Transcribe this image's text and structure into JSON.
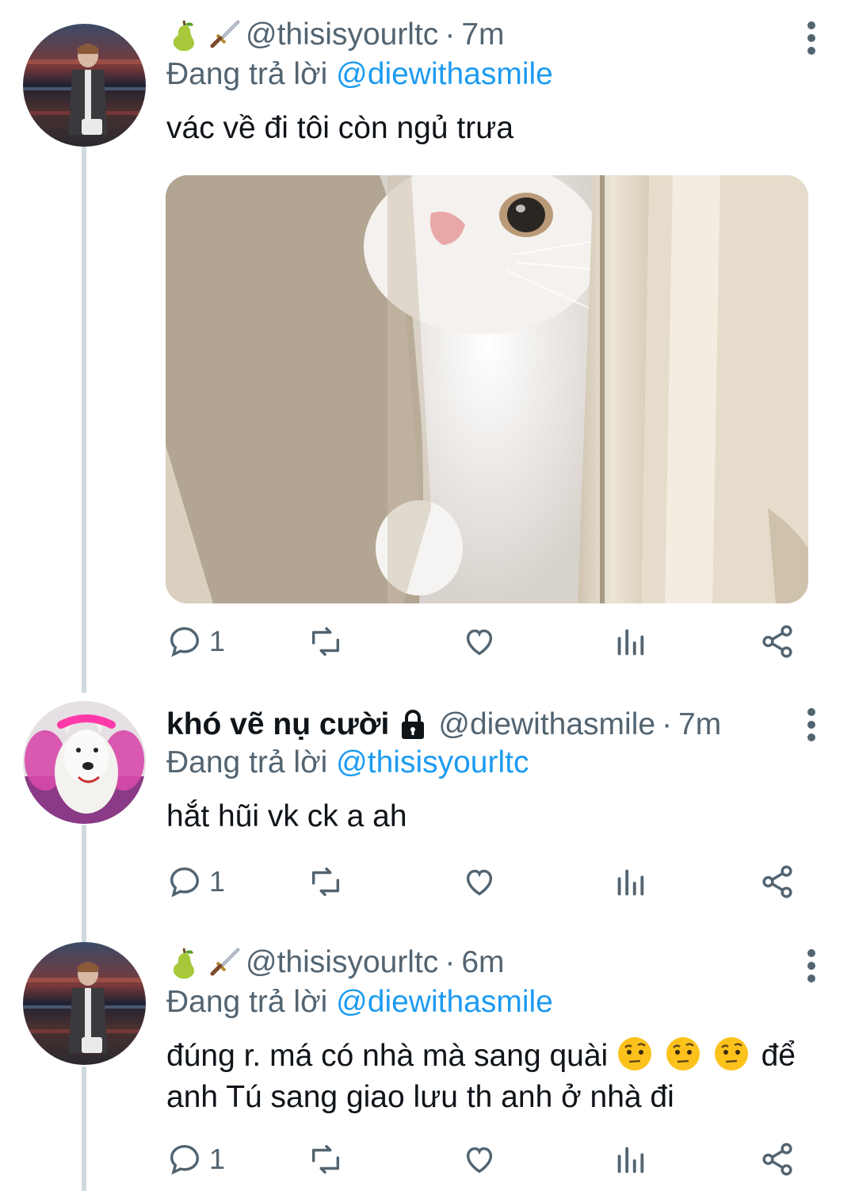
{
  "tweets": [
    {
      "header_emojis": [
        "pear",
        "dagger"
      ],
      "display_name": "",
      "locked": false,
      "handle": "@thisisyourltc",
      "time": "7m",
      "replying_label": "Đang trả lời",
      "replying_to": "@diewithasmile",
      "text": "vác về đi tôi còn ngủ trưa",
      "has_media": true,
      "reply_count": "1"
    },
    {
      "header_emojis": [],
      "display_name": "khó vẽ nụ cười",
      "locked": true,
      "handle": "@diewithasmile",
      "time": "7m",
      "replying_label": "Đang trả lời",
      "replying_to": "@thisisyourltc",
      "text": "hắt hũi vk ck a ah",
      "has_media": false,
      "reply_count": "1"
    },
    {
      "header_emojis": [
        "pear",
        "dagger"
      ],
      "display_name": "",
      "locked": false,
      "handle": "@thisisyourltc",
      "time": "6m",
      "replying_label": "Đang trả lời",
      "replying_to": "@diewithasmile",
      "text_line1_part1": "đúng r. má có nhà mà sang quài",
      "text_emojis": [
        "face-with-raised-eyebrow",
        "face-with-raised-eyebrow",
        "face-with-raised-eyebrow"
      ],
      "text_line1_part2": "để",
      "text_line2": "anh Tú sang giao lưu th anh ở nhà đi",
      "has_media": false,
      "reply_count": "1"
    }
  ],
  "actions": [
    "reply-icon",
    "retweet-icon",
    "like-icon",
    "analytics-icon",
    "share-icon"
  ],
  "colors": {
    "link": "#1d9bf0",
    "secondary": "#536471",
    "thread_line": "#cfd9de"
  }
}
